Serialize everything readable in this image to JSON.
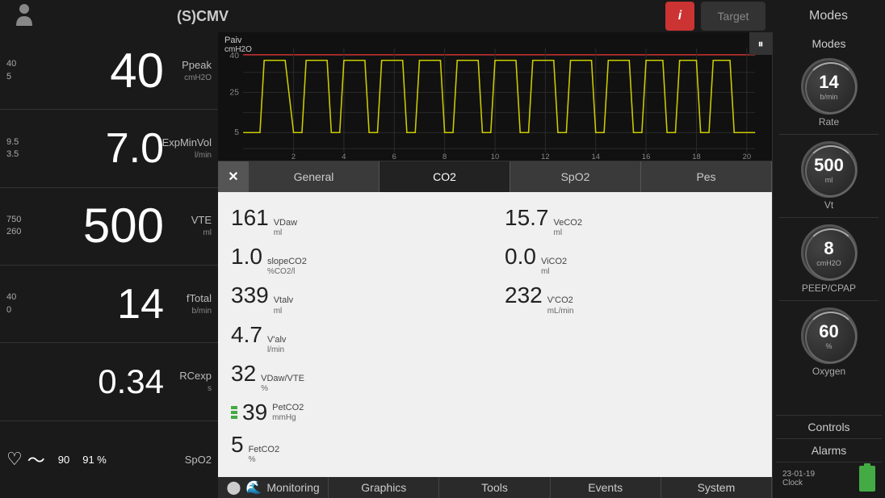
{
  "header": {
    "patient_icon": "👤",
    "mode": "(S)CMV",
    "info_label": "i",
    "target_label": "Target",
    "modes_label": "Modes"
  },
  "left_panel": {
    "metrics": [
      {
        "upper_bound": "40",
        "lower_bound": "5",
        "value": "40",
        "name": "Ppeak",
        "unit": "cmH2O",
        "size": "large"
      },
      {
        "upper_bound": "9.5",
        "lower_bound": "3.5",
        "value": "7.0",
        "name": "ExpMinVol",
        "unit": "l/min",
        "size": "medium"
      },
      {
        "upper_bound": "750",
        "lower_bound": "260",
        "value": "500",
        "name": "VTE",
        "unit": "ml",
        "size": "large"
      },
      {
        "upper_bound": "40",
        "lower_bound": "0",
        "value": "14",
        "name": "fTotal",
        "unit": "b/min",
        "size": "medium"
      },
      {
        "upper_bound": "",
        "lower_bound": "",
        "value": "0.34",
        "name": "RCexp",
        "unit": "s",
        "size": "small"
      }
    ],
    "spo2": {
      "val1": "90",
      "val2": "91 %",
      "label": "SpO2"
    }
  },
  "waveform": {
    "label": "Paiv",
    "unit": "cmH2O",
    "freeze_icon": "⏸"
  },
  "dialog": {
    "close_label": "✕",
    "tabs": [
      {
        "label": "General",
        "active": false
      },
      {
        "label": "CO2",
        "active": true
      },
      {
        "label": "SpO2",
        "active": false
      },
      {
        "label": "Pes",
        "active": false
      }
    ],
    "co2_data": [
      {
        "value": "161",
        "name": "VDaw",
        "unit": "ml"
      },
      {
        "value": "15.7",
        "name": "VeCO2",
        "unit": "ml"
      },
      {
        "value": "1.0",
        "name": "slopeCO2",
        "unit": "%CO2/l"
      },
      {
        "value": "0.0",
        "name": "ViCO2",
        "unit": "ml"
      },
      {
        "value": "339",
        "name": "Vtalv",
        "unit": "ml"
      },
      {
        "value": "232",
        "name": "V'CO2",
        "unit": "mL/min"
      },
      {
        "value": "4.7",
        "name": "V'alv",
        "unit": "l/min"
      },
      {
        "value": "",
        "name": "",
        "unit": ""
      },
      {
        "value": "32",
        "name": "VDaw/VTE",
        "unit": "%"
      },
      {
        "value": "",
        "name": "",
        "unit": ""
      },
      {
        "value": "39",
        "name": "PetCO2",
        "unit": "mmHg",
        "has_bar": true
      },
      {
        "value": "",
        "name": "",
        "unit": ""
      },
      {
        "value": "5",
        "name": "FetCO2",
        "unit": "%"
      },
      {
        "value": "",
        "name": "",
        "unit": ""
      }
    ]
  },
  "bottom_nav": {
    "items": [
      {
        "label": "Monitoring",
        "icon": "📊",
        "active": false
      },
      {
        "label": "Graphics",
        "active": false
      },
      {
        "label": "Tools",
        "active": false
      },
      {
        "label": "Events",
        "active": false
      },
      {
        "label": "System",
        "active": false
      }
    ],
    "icons": [
      "⬤",
      "🌊"
    ]
  },
  "right_panel": {
    "modes_label": "Modes",
    "knobs": [
      {
        "value": "14",
        "unit": "b/min",
        "label": "Rate"
      },
      {
        "value": "500",
        "unit": "ml",
        "label": "Vt"
      },
      {
        "value": "8",
        "unit": "cmH2O",
        "label": "PEEP/CPAP"
      },
      {
        "value": "60",
        "unit": "%",
        "label": "Oxygen"
      }
    ],
    "controls_label": "Controls",
    "alarms_label": "Alarms",
    "clock": "23-01-19",
    "clock_label": "Clock"
  }
}
